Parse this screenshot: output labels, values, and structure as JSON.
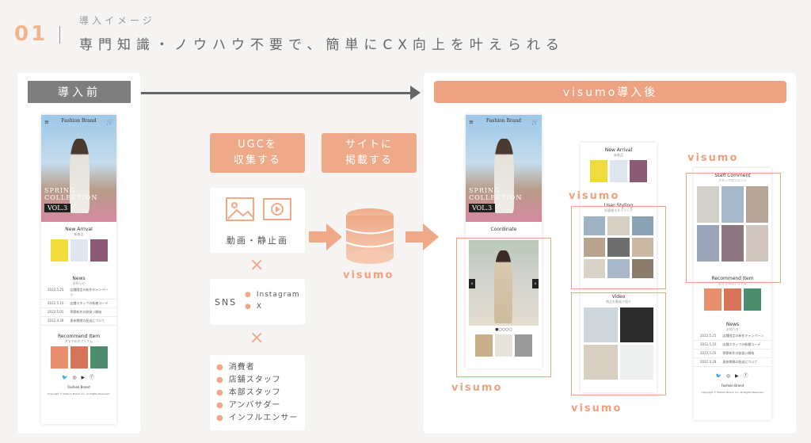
{
  "header": {
    "number": "01",
    "subtitle": "導入イメージ",
    "title": "専門知識・ノウハウ不要で、簡単にCX向上を叶えられる"
  },
  "before": {
    "label": "導入前"
  },
  "after": {
    "label": "visumo導入後"
  },
  "phone": {
    "brand": "Fashion Brand",
    "menu_icon": "≡",
    "cart_icon": "🛒",
    "spring": "SPRING COLLECTION",
    "vol": "VOL.3",
    "new_arrival": "New Arrival",
    "new_arrival_sub": "新着品",
    "news": "News",
    "news_sub": "お知らせ",
    "news_rows": [
      {
        "d": "2022.5.25",
        "t": "店舗限定の新作キャンペーン"
      },
      {
        "d": "2022.5.10",
        "t": "店舗スタッフの新着コーデ"
      },
      {
        "d": "2022.5.05",
        "t": "季節新作の取扱い開始"
      },
      {
        "d": "2022.4.28",
        "t": "連休期間の配送について"
      }
    ],
    "recommend": "Recommend Item",
    "recommend_sub": "おすすめのアイテム",
    "social": "🐦 ◎ ▶ ⓕ",
    "footer_brand": "Fashion Brand",
    "copyright": "Copyright © Fashion Brand, Inc. All Rights Reserved."
  },
  "process": {
    "ugc_label": "UGCを\n収集する",
    "site_label": "サイトに\n掲載する",
    "media_label": "動画・静止画",
    "sns_label": "SNS",
    "sns_items": [
      "Instagram",
      "X"
    ],
    "cross": "×",
    "people": [
      "消費者",
      "店舗スタッフ",
      "本部スタッフ",
      "アンバサダー",
      "インフルエンサー"
    ],
    "db_label": "visumo"
  },
  "after_phone": {
    "coordinate": "Coordinate",
    "new_arrival": "New Arrival",
    "new_arrival_sub": "新着品",
    "user_styling": "User Styling",
    "user_styling_sub": "お客様スタイリング",
    "video": "Video",
    "video_sub": "商品を動画で紹介",
    "staff_comment": "Staff Comment",
    "staff_comment_sub": "スタッフのコメント",
    "recommend": "Recommend Item",
    "recommend_sub": "おすすめのアイテム",
    "news": "News",
    "news_sub": "お知らせ",
    "visumo_labels": [
      "visumo",
      "visumo",
      "visumo",
      "visumo"
    ]
  },
  "colors": {
    "accent": "#eda381",
    "gray": "#7e7e7e"
  }
}
